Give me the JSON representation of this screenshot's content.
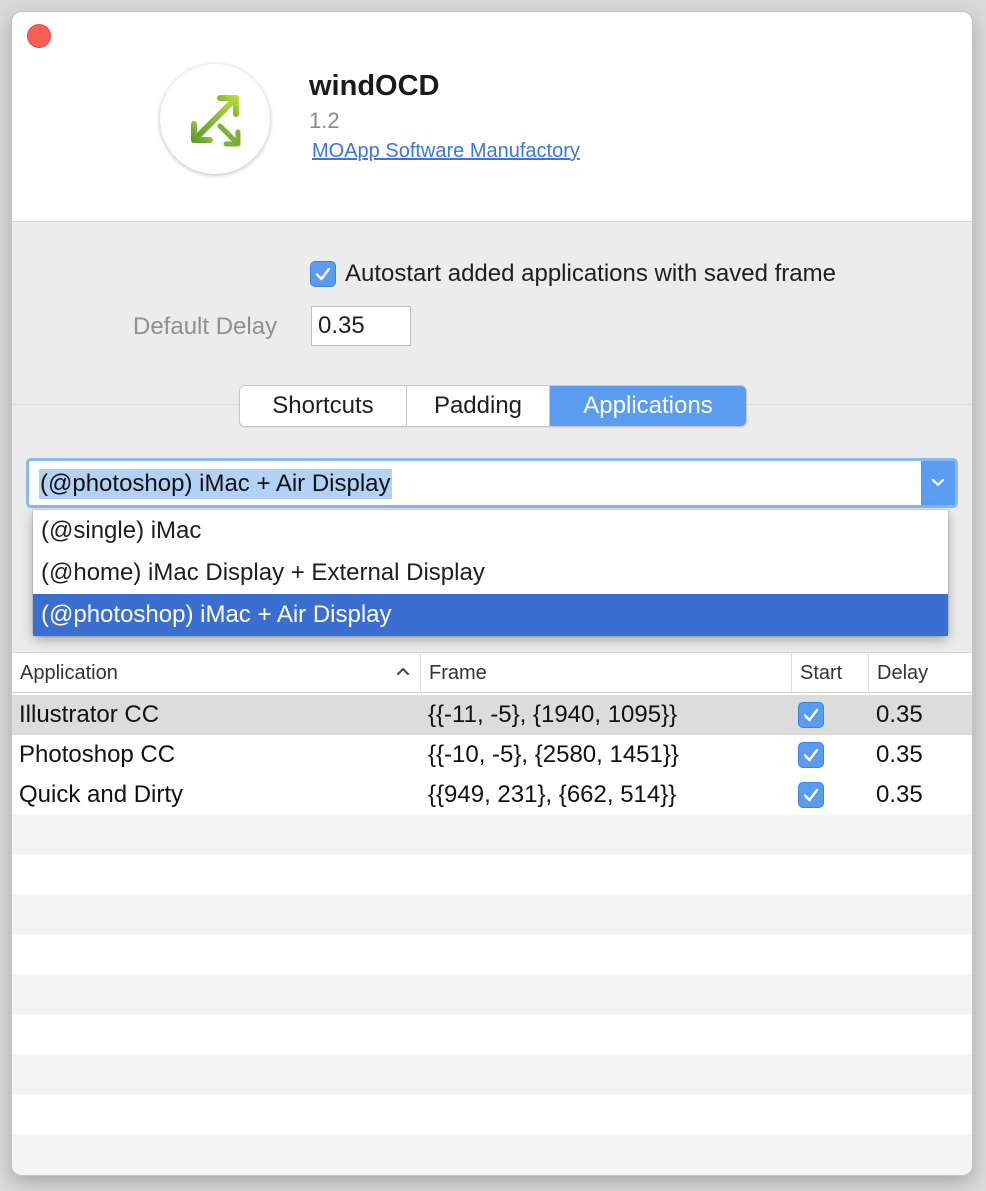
{
  "app": {
    "name": "windOCD",
    "version": "1.2",
    "developer": "MOApp Software Manufactory",
    "icon": "resize-arrows-icon"
  },
  "settings": {
    "autostart_label": "Autostart added applications with saved frame",
    "autostart_checked": true,
    "default_delay_label": "Default Delay",
    "default_delay_value": "0.35"
  },
  "tabs": [
    {
      "label": "Shortcuts",
      "selected": false
    },
    {
      "label": "Padding",
      "selected": false
    },
    {
      "label": "Applications",
      "selected": true
    }
  ],
  "profile": {
    "selected": "(@photoshop) iMac + Air Display",
    "options": [
      "(@single) iMac",
      "(@home) iMac Display + External Display",
      "(@photoshop) iMac + Air Display"
    ]
  },
  "table": {
    "columns": {
      "application": "Application",
      "frame": "Frame",
      "start": "Start",
      "delay": "Delay"
    },
    "rows": [
      {
        "application": "Illustrator CC",
        "frame": "{{-11, -5}, {1940, 1095}}",
        "start": true,
        "delay": "0.35"
      },
      {
        "application": "Photoshop CC",
        "frame": "{{-10, -5}, {2580, 1451}}",
        "start": true,
        "delay": "0.35"
      },
      {
        "application": "Quick and Dirty",
        "frame": "{{949, 231}, {662, 514}}",
        "start": true,
        "delay": "0.35"
      }
    ]
  },
  "colors": {
    "accent": "#5a9cf0",
    "selection": "#3a6fd1",
    "close": "#fc5f57",
    "link": "#3b78d6"
  }
}
